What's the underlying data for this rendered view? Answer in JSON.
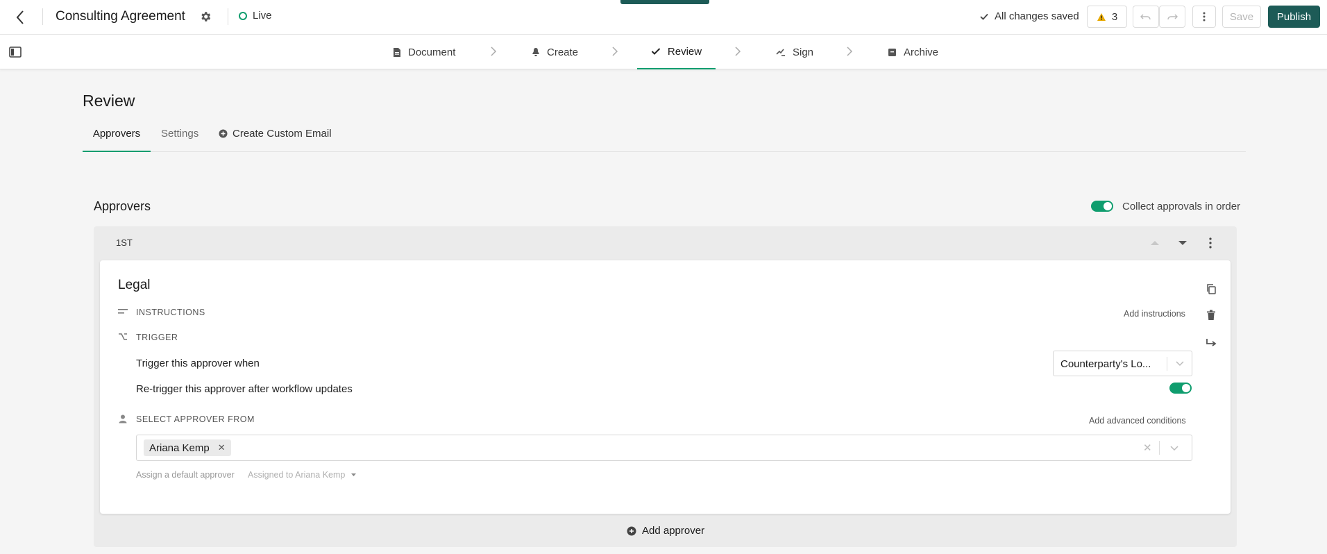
{
  "header": {
    "title": "Consulting Agreement",
    "status": "Live",
    "saved_text": "All changes saved",
    "warnings_count": "3",
    "save_label": "Save",
    "publish_label": "Publish"
  },
  "steps": [
    {
      "label": "Document",
      "icon": "document-icon"
    },
    {
      "label": "Create",
      "icon": "bell-icon"
    },
    {
      "label": "Review",
      "icon": "check-icon"
    },
    {
      "label": "Sign",
      "icon": "sign-icon"
    },
    {
      "label": "Archive",
      "icon": "archive-icon"
    }
  ],
  "page": {
    "title": "Review",
    "tabs": [
      "Approvers",
      "Settings",
      "Create Custom Email"
    ]
  },
  "approvers": {
    "heading": "Approvers",
    "collect_in_order_label": "Collect approvals in order",
    "collect_in_order": true,
    "group_label": "1ST",
    "card": {
      "title": "Legal",
      "instructions_label": "INSTRUCTIONS",
      "add_instructions": "Add instructions",
      "trigger_label": "TRIGGER",
      "trigger_when_label": "Trigger this approver when",
      "trigger_value": "Counterparty's Lo...",
      "retrigger_label": "Re-trigger this approver after workflow updates",
      "retrigger": true,
      "select_label": "SELECT APPROVER FROM",
      "advanced_conditions": "Add advanced conditions",
      "selected_approver": "Ariana Kemp",
      "default_approver_label": "Assign a default approver",
      "default_approver_value": "Assigned to Ariana Kemp"
    },
    "add_approver_label": "Add approver"
  },
  "colors": {
    "brand": "#1d5b57",
    "accent_green": "#0f9d6e",
    "warning": "#e8a900"
  }
}
